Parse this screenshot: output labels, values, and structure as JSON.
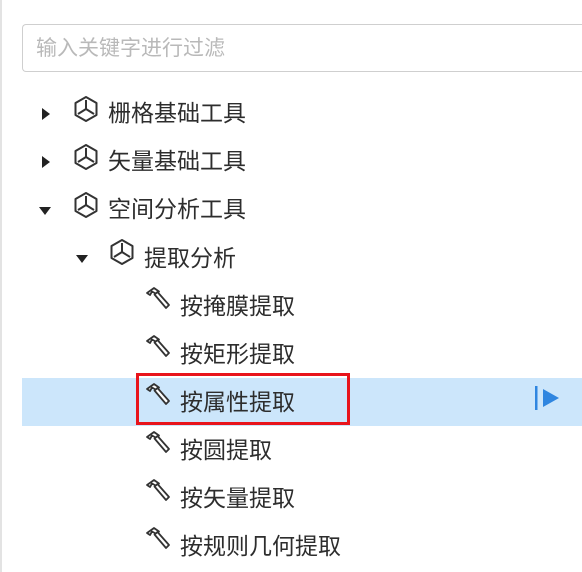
{
  "filter": {
    "placeholder": "输入关键字进行过滤",
    "value": ""
  },
  "tree": [
    {
      "label": "栅格基础工具",
      "icon": "cube-icon",
      "state": "collapsed",
      "level": 0
    },
    {
      "label": "矢量基础工具",
      "icon": "cube-icon",
      "state": "collapsed",
      "level": 0
    },
    {
      "label": "空间分析工具",
      "icon": "cube-icon",
      "state": "expanded",
      "level": 0
    },
    {
      "label": "提取分析",
      "icon": "cube-icon",
      "state": "expanded",
      "level": 1
    },
    {
      "label": "按掩膜提取",
      "icon": "hammer-icon",
      "state": "leaf",
      "level": 2
    },
    {
      "label": "按矩形提取",
      "icon": "hammer-icon",
      "state": "leaf",
      "level": 2
    },
    {
      "label": "按属性提取",
      "icon": "hammer-icon",
      "state": "leaf",
      "level": 2,
      "selected": true
    },
    {
      "label": "按圆提取",
      "icon": "hammer-icon",
      "state": "leaf",
      "level": 2
    },
    {
      "label": "按矢量提取",
      "icon": "hammer-icon",
      "state": "leaf",
      "level": 2
    },
    {
      "label": "按规则几何提取",
      "icon": "hammer-icon",
      "state": "leaf",
      "level": 2
    }
  ],
  "colors": {
    "selected_row": "#cce6fb",
    "highlight_border": "#e8141b",
    "run_button": "#2f86e0"
  }
}
